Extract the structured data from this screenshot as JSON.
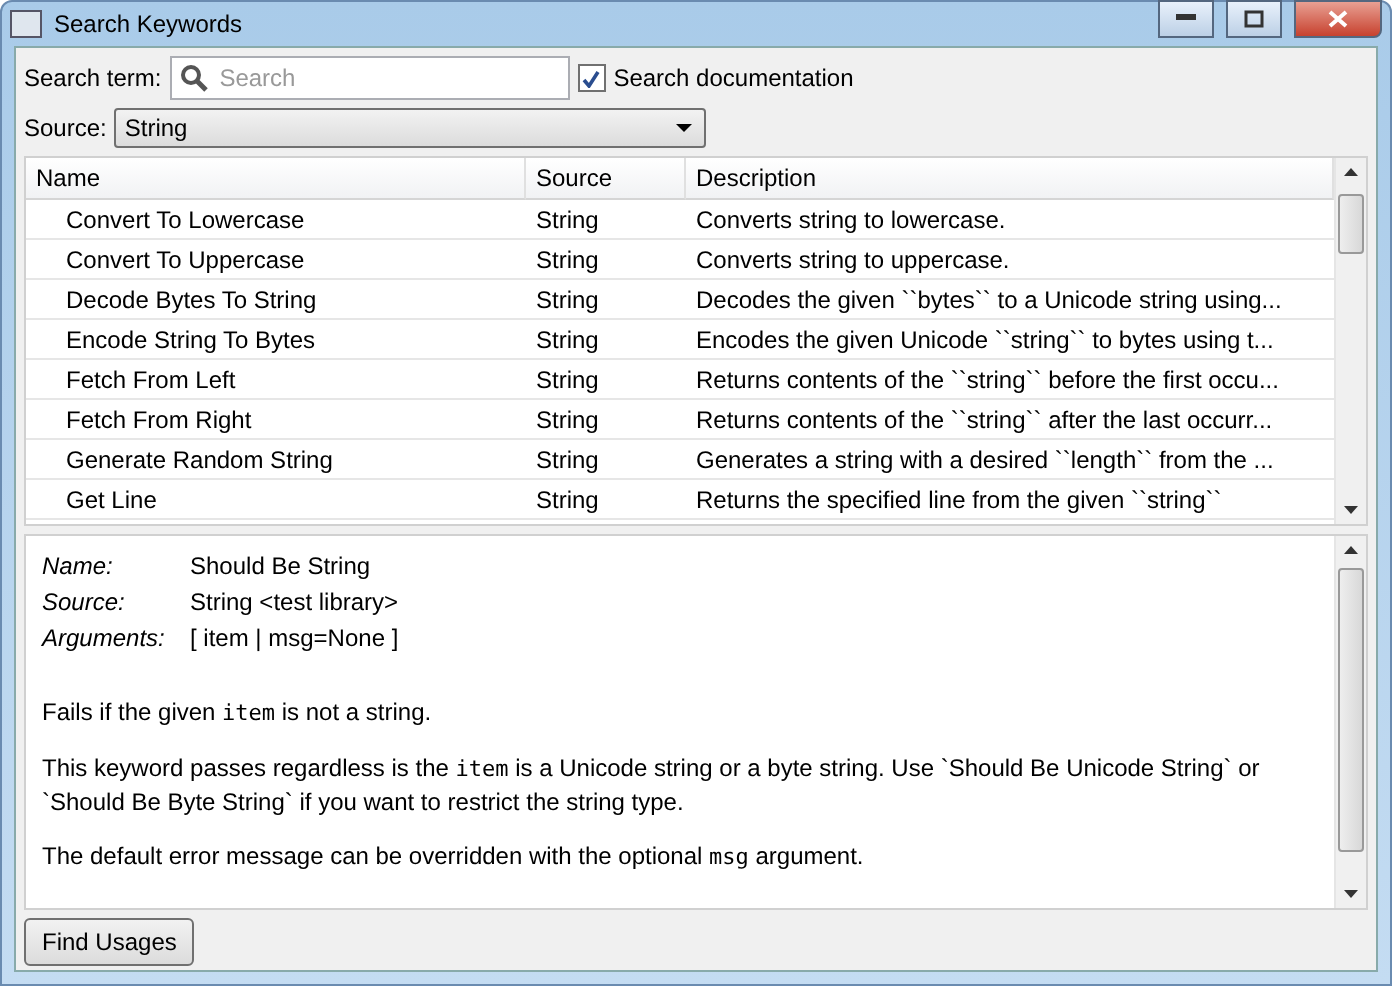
{
  "window": {
    "title": "Search Keywords"
  },
  "search": {
    "label": "Search term:",
    "placeholder": "Search"
  },
  "search_documentation": {
    "label": "Search documentation",
    "checked": true
  },
  "source": {
    "label": "Source:",
    "value": "String"
  },
  "table": {
    "columns": [
      "Name",
      "Source",
      "Description"
    ],
    "rows": [
      {
        "name": "Convert To Lowercase",
        "source": "String",
        "description": "Converts string to lowercase."
      },
      {
        "name": "Convert To Uppercase",
        "source": "String",
        "description": "Converts string to uppercase."
      },
      {
        "name": "Decode Bytes To String",
        "source": "String",
        "description": "Decodes the given ``bytes`` to a Unicode string using..."
      },
      {
        "name": "Encode String To Bytes",
        "source": "String",
        "description": "Encodes the given Unicode ``string`` to bytes using t..."
      },
      {
        "name": "Fetch From Left",
        "source": "String",
        "description": "Returns contents of the ``string`` before the first occu..."
      },
      {
        "name": "Fetch From Right",
        "source": "String",
        "description": "Returns contents of the ``string`` after the last occurr..."
      },
      {
        "name": "Generate Random String",
        "source": "String",
        "description": "Generates a string with a desired ``length`` from the ..."
      },
      {
        "name": "Get Line",
        "source": "String",
        "description": "Returns the specified line from the given ``string``"
      }
    ]
  },
  "details": {
    "fields": [
      {
        "label": "Name:",
        "value": "Should Be String"
      },
      {
        "label": "Source:",
        "value": "String <test library>"
      },
      {
        "label": "Arguments:",
        "value": "[ item | msg=None ]"
      }
    ],
    "paragraphs": [
      [
        {
          "kind": "text",
          "text": "Fails if the given "
        },
        {
          "kind": "code",
          "text": "item"
        },
        {
          "kind": "text",
          "text": " is not a string."
        }
      ],
      [
        {
          "kind": "text",
          "text": "This keyword passes regardless is the "
        },
        {
          "kind": "code",
          "text": "item"
        },
        {
          "kind": "text",
          "text": " is a Unicode string or a byte string. Use `Should Be Unicode String` or `Should Be Byte String` if you want to restrict the string type."
        }
      ],
      [
        {
          "kind": "text",
          "text": "The default error message can be overridden with the optional "
        },
        {
          "kind": "code",
          "text": "msg"
        },
        {
          "kind": "text",
          "text": " argument."
        }
      ]
    ]
  },
  "buttons": [
    "Find Usages"
  ]
}
